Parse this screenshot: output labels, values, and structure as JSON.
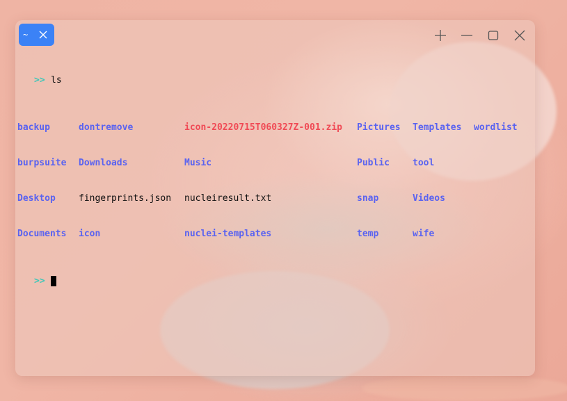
{
  "tab": {
    "label": "~"
  },
  "window_controls": [
    "new-tab",
    "minimize",
    "maximize",
    "close"
  ],
  "terminal": {
    "prompt_symbol": ">>",
    "command": "ls",
    "rows": [
      [
        {
          "text": "backup",
          "kind": "dir"
        },
        {
          "text": "dontremove",
          "kind": "dir"
        },
        {
          "text": "icon-20220715T060327Z-001.zip",
          "kind": "archive"
        },
        {
          "text": "Pictures",
          "kind": "dir"
        },
        {
          "text": "Templates",
          "kind": "dir"
        },
        {
          "text": "wordlist",
          "kind": "dir"
        }
      ],
      [
        {
          "text": "burpsuite",
          "kind": "dir"
        },
        {
          "text": "Downloads",
          "kind": "dir"
        },
        {
          "text": "Music",
          "kind": "dir"
        },
        {
          "text": "Public",
          "kind": "dir"
        },
        {
          "text": "tool",
          "kind": "dir"
        },
        {
          "text": "",
          "kind": "dir"
        }
      ],
      [
        {
          "text": "Desktop",
          "kind": "dir"
        },
        {
          "text": "fingerprints.json",
          "kind": "file"
        },
        {
          "text": "nucleiresult.txt",
          "kind": "file"
        },
        {
          "text": "snap",
          "kind": "dir"
        },
        {
          "text": "Videos",
          "kind": "dir"
        },
        {
          "text": "",
          "kind": "dir"
        }
      ],
      [
        {
          "text": "Documents",
          "kind": "dir"
        },
        {
          "text": "icon",
          "kind": "dir"
        },
        {
          "text": "nuclei-templates",
          "kind": "dir"
        },
        {
          "text": "temp",
          "kind": "dir"
        },
        {
          "text": "wife",
          "kind": "dir"
        },
        {
          "text": "",
          "kind": "dir"
        }
      ]
    ]
  },
  "colors": {
    "tab_bg": "#3b82f6",
    "prompt": "#3ec7b8",
    "directory": "#5a63f0",
    "archive": "#f04a55",
    "text": "#111111"
  }
}
